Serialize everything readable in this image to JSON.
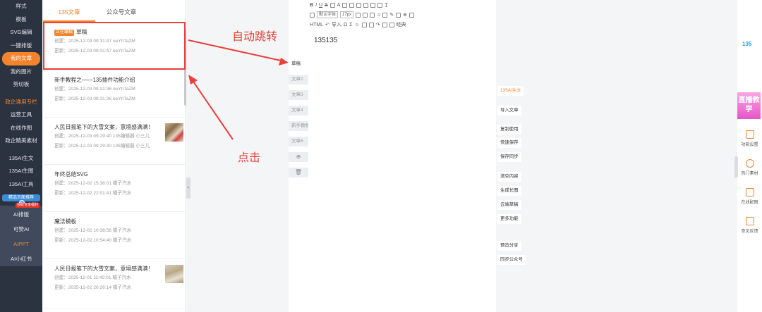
{
  "nav": {
    "group1": [
      "样式",
      "模板",
      "SVG编辑",
      "一键排版",
      "我的文章",
      "我的图片",
      "剪切板"
    ],
    "group2": [
      "政企通用专栏",
      "运营工具",
      "在线作图",
      "政企精美素材"
    ],
    "group3": [
      "135AI生文",
      "135AI生图",
      "135AI工具"
    ],
    "promo": "精选页面推荐",
    "hot_badge": "领取专享福利",
    "ai_items": [
      "AI排版",
      "可赞AI",
      "AIPPT",
      "AI小红书"
    ]
  },
  "panel": {
    "tabs": [
      "135文章",
      "公众号文章"
    ],
    "articles": [
      {
        "badge": "正在编辑",
        "title": "草稿",
        "created": "创建：2025-12-03 09:31:47  oeYhTaZM",
        "updated": "更新：2025-12-03 09:31:47  oeYhTaZM"
      },
      {
        "title": "新手教程之——135插件功能介绍",
        "created": "创建：2025-12-03 09:31:36  oeYhTaZM",
        "updated": "更新：2025-12-03 09:31:36  oeYhTaZM"
      },
      {
        "title": "人民日报笔下的大雪文案，意境感满满！",
        "created": "创建：2025-12-03 09:29:40  135编辑器 小三儿",
        "updated": "更新：2025-12-03 09:29:40  135编辑器 小三儿"
      },
      {
        "title": "年终总结SVG",
        "created": "创建：2025-12-02 15:38:01  橘子汽水",
        "updated": "更新：2025-12-02 22:01:41  橘子汽水"
      },
      {
        "title": "魔法模板",
        "created": "创建：2025-12-02 10:38:56  橘子汽水",
        "updated": "更新：2025-12-02 10:54:40  橘子汽水"
      },
      {
        "title": "人民日报笔下的大雪文案，意境感满满！",
        "created": "创建：2025-12-01 11:43:01  橘子汽水",
        "updated": "更新：2025-12-02 20:26:14  橘子汽水"
      }
    ]
  },
  "annotations": {
    "auto_jump": "自动跳转",
    "click": "点击"
  },
  "doc_tabs": [
    "草稿",
    "文章2",
    "文章3",
    "文章4",
    "新手教程",
    "文章6"
  ],
  "editor": {
    "font_select": "默认字体",
    "size_select": "17px",
    "import_label": "导入",
    "classic_label": "经典",
    "html_label": "HTML",
    "content": "135135"
  },
  "commands": [
    "135AI生文",
    "导入文章",
    "复制使用",
    "快速保存",
    "保存同步",
    "清空内容",
    "生成长图",
    "云端草稿",
    "更多功能",
    "预览分享",
    "同步公众号"
  ],
  "side_tools": {
    "logo": "135",
    "live": "直播教学",
    "items": [
      "功能设置",
      "热门素材",
      "在线配图",
      "意见反馈"
    ]
  },
  "colors": {
    "accent": "#f3842b",
    "nav_bg": "#2c3340",
    "annotation": "#e8413b"
  }
}
